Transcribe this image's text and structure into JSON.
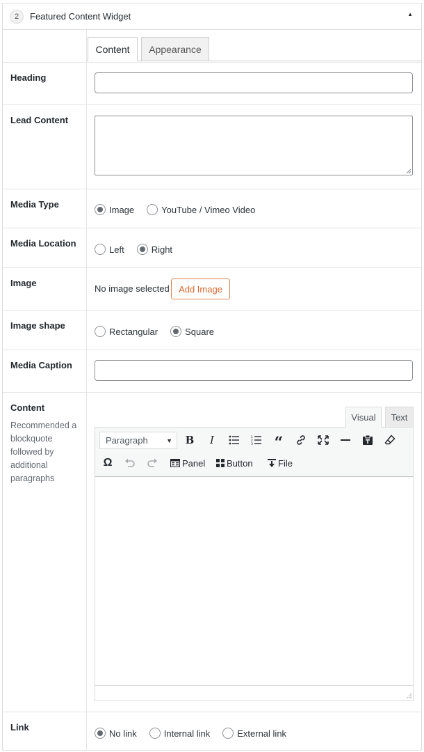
{
  "widget": {
    "number": "2",
    "title": "Featured Content Widget",
    "toggle_icon": "triangle-up-icon"
  },
  "tabs": [
    {
      "label": "Content",
      "active": true
    },
    {
      "label": "Appearance",
      "active": false
    }
  ],
  "fields": {
    "heading": {
      "label": "Heading",
      "value": ""
    },
    "lead_content": {
      "label": "Lead Content",
      "value": ""
    },
    "media_type": {
      "label": "Media Type",
      "options": [
        {
          "label": "Image",
          "checked": true
        },
        {
          "label": "YouTube / Vimeo Video",
          "checked": false
        }
      ]
    },
    "media_location": {
      "label": "Media Location",
      "options": [
        {
          "label": "Left",
          "checked": false
        },
        {
          "label": "Right",
          "checked": true
        }
      ]
    },
    "image": {
      "label": "Image",
      "status": "No image selected",
      "button": "Add Image"
    },
    "image_shape": {
      "label": "Image shape",
      "options": [
        {
          "label": "Rectangular",
          "checked": false
        },
        {
          "label": "Square",
          "checked": true
        }
      ]
    },
    "media_caption": {
      "label": "Media Caption",
      "value": ""
    },
    "content": {
      "label": "Content",
      "description": "Recommended a blockquote followed by additional paragraphs",
      "editor": {
        "tabs": [
          "Visual",
          "Text"
        ],
        "active_tab": "Visual",
        "format_select": "Paragraph",
        "buttons": [
          "bold-icon",
          "italic-icon",
          "bullet-list-icon",
          "numbered-list-icon",
          "blockquote-icon",
          "link-icon",
          "fullscreen-icon",
          "horizontal-rule-icon",
          "paste-as-text-icon",
          "clear-formatting-icon",
          "special-character-icon",
          "undo-icon",
          "redo-icon"
        ],
        "panel_label": "Panel",
        "button_label": "Button",
        "file_label": "File",
        "body": ""
      }
    },
    "link": {
      "label": "Link",
      "options": [
        {
          "label": "No link",
          "checked": true
        },
        {
          "label": "Internal link",
          "checked": false
        },
        {
          "label": "External link",
          "checked": false
        }
      ]
    }
  },
  "colors": {
    "accent_button": "#d8682e",
    "border": "#dddddd"
  }
}
